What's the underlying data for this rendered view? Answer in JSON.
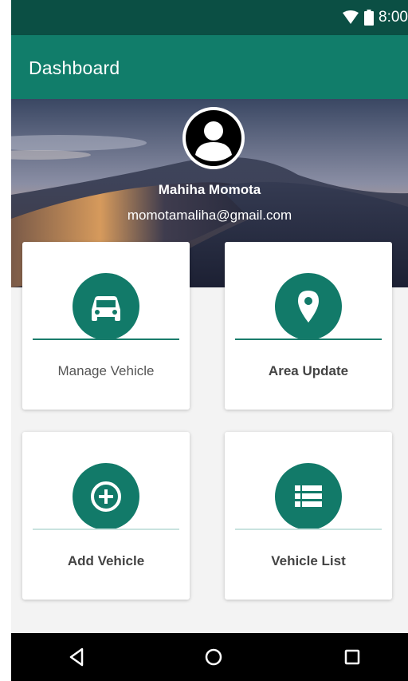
{
  "status_bar": {
    "time": "8:00",
    "icons": [
      "wifi-icon",
      "battery-icon"
    ]
  },
  "app_bar": {
    "title": "Dashboard"
  },
  "profile": {
    "avatar_icon": "account-circle-icon",
    "name": "Mahiha Momota",
    "email": "momotamaliha@gmail.com"
  },
  "cards": [
    {
      "label": "Manage Vehicle",
      "icon": "car-icon"
    },
    {
      "label": "Area Update",
      "icon": "location-pin-icon"
    },
    {
      "label": "Add Vehicle",
      "icon": "add-circle-icon"
    },
    {
      "label": "Vehicle List",
      "icon": "list-icon"
    }
  ],
  "nav_bar": {
    "buttons": [
      "back-icon",
      "home-icon",
      "recents-icon"
    ]
  },
  "colors": {
    "status_bar": "#0b4f44",
    "primary": "#117d6a",
    "icon_circle": "#127a69",
    "background": "#f3f3f3"
  }
}
